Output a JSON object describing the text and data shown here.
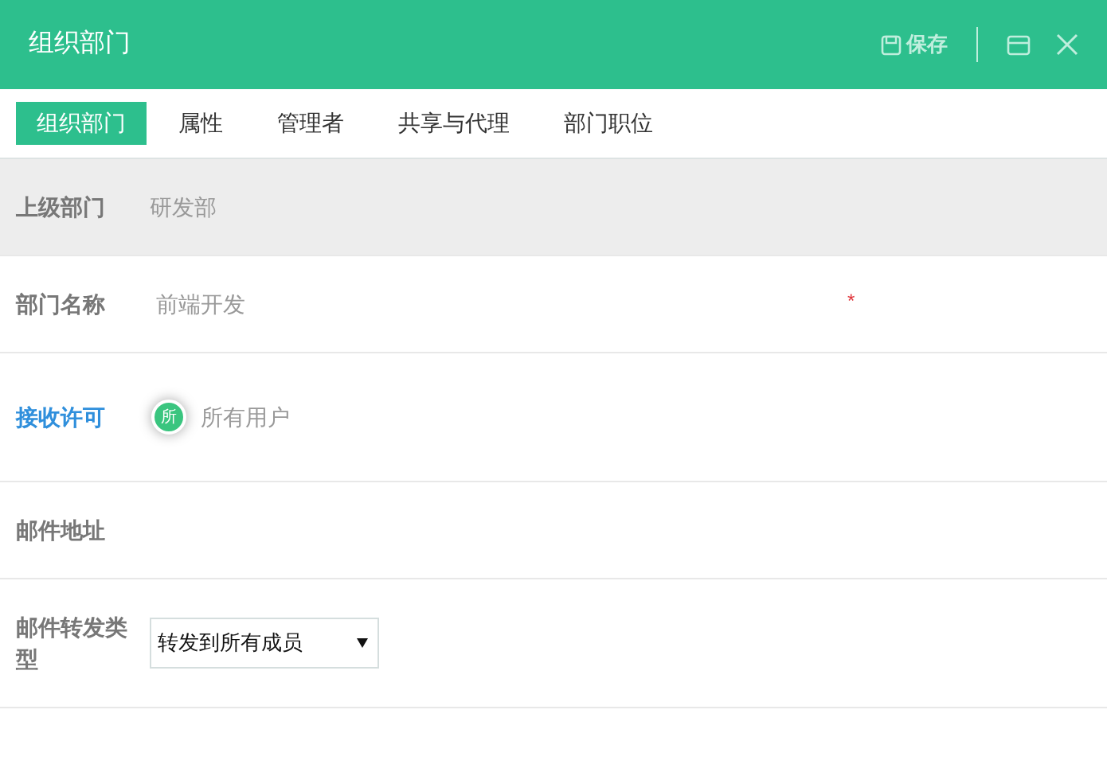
{
  "window": {
    "title": "组织部门",
    "save_label": "保存"
  },
  "tabs": [
    {
      "label": "组织部门",
      "selected": true
    },
    {
      "label": "属性",
      "selected": false
    },
    {
      "label": "管理者",
      "selected": false
    },
    {
      "label": "共享与代理",
      "selected": false
    },
    {
      "label": "部门职位",
      "selected": false
    }
  ],
  "fields": [
    {
      "kind": "readonly",
      "label": "上级部门",
      "value": "研发部",
      "active": false
    },
    {
      "kind": "text",
      "label": "部门名称",
      "placeholder": "前端开发",
      "active": false,
      "required_mark": "*"
    },
    {
      "kind": "user",
      "label": "接收许可",
      "avatar": "所",
      "value": "所有用户",
      "active": true
    },
    {
      "kind": "empty",
      "label": "邮件地址",
      "active": false
    },
    {
      "kind": "select",
      "label": "邮件转发类型",
      "value": "转发到所有成员",
      "active": false
    }
  ]
}
